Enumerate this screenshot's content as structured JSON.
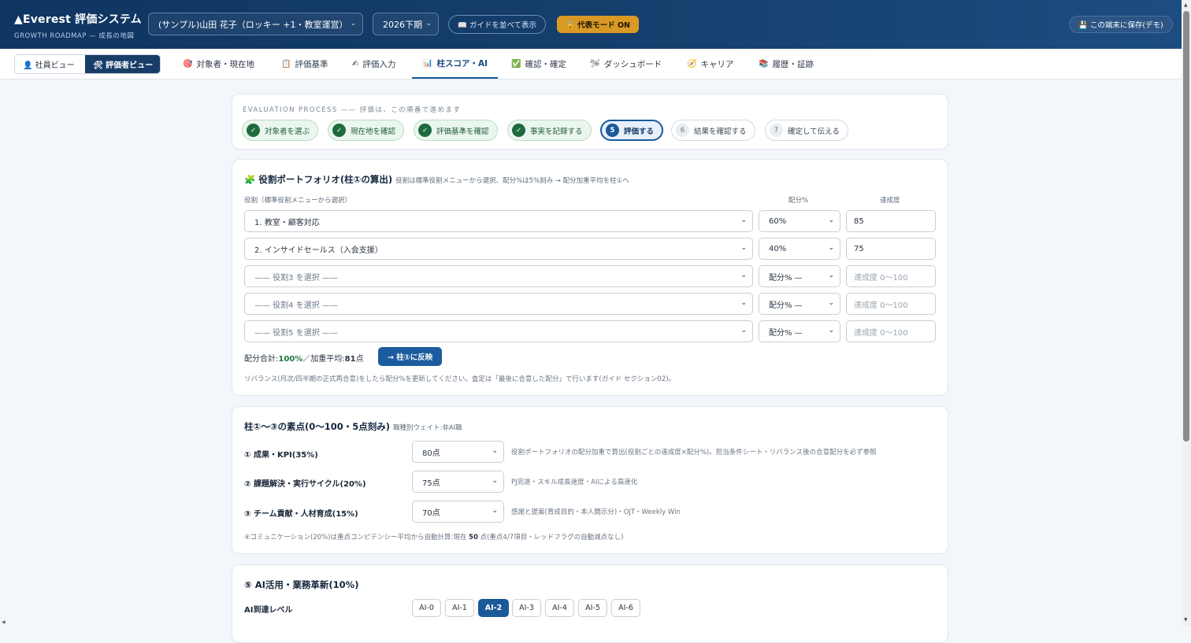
{
  "header": {
    "logo_title": "▲Everest 評価システム",
    "logo_subtitle": "GROWTH ROADMAP — 成長の地図",
    "person_select": "(サンプル)山田 花子（ロッキー +1・教室運営）",
    "period_select": "2026下期",
    "guide_button": "📖 ガイドを並べて表示",
    "rep_mode_button": "🔒 代表モード ON",
    "save_button": "💾 この端末に保存(デモ)"
  },
  "view_toggle": {
    "employee": "👤 社員ビュー",
    "evaluator": "🛠 評価者ビュー"
  },
  "tabs": [
    {
      "icon": "🎯",
      "label": "対象者・現在地"
    },
    {
      "icon": "📋",
      "label": "評価基準"
    },
    {
      "icon": "✍",
      "label": "評価入力"
    },
    {
      "icon": "📊",
      "label": "柱スコア・AI"
    },
    {
      "icon": "✅",
      "label": "確認・確定"
    },
    {
      "icon": "🛩",
      "label": "ダッシュボード"
    },
    {
      "icon": "🧭",
      "label": "キャリア"
    },
    {
      "icon": "📚",
      "label": "履歴・証跡"
    }
  ],
  "process": {
    "label": "EVALUATION PROCESS —— 評価は、この順番で進めます",
    "steps": [
      {
        "badge": "✓",
        "label": "対象者を選ぶ"
      },
      {
        "badge": "✓",
        "label": "現在地を確認"
      },
      {
        "badge": "✓",
        "label": "評価基準を確認"
      },
      {
        "badge": "✓",
        "label": "事実を記録する"
      },
      {
        "badge": "5",
        "label": "評価する"
      },
      {
        "badge": "6",
        "label": "結果を確認する"
      },
      {
        "badge": "7",
        "label": "確定して伝える"
      }
    ]
  },
  "portfolio": {
    "title": "🧩 役割ポートフォリオ(柱①の算出)",
    "subtitle": "役割は標準役割メニューから選択、配分%は5%刻み → 配分加重平均を柱①へ",
    "col_role": "役割（標準役割メニューから選択）",
    "col_alloc": "配分%",
    "col_ach": "達成度",
    "rows": [
      {
        "role": "1. 教室・顧客対応",
        "alloc": "60%",
        "ach": "85"
      },
      {
        "role": "2. インサイドセールス（入会支援）",
        "alloc": "40%",
        "ach": "75"
      },
      {
        "role": "—— 役割3 を選択 ——",
        "alloc": "配分% —",
        "ach": "達成度 0〜100"
      },
      {
        "role": "—— 役割4 を選択 ——",
        "alloc": "配分% —",
        "ach": "達成度 0〜100"
      },
      {
        "role": "—— 役割5 を選択 ——",
        "alloc": "配分% —",
        "ach": "達成度 0〜100"
      }
    ],
    "sum_label": "配分合計:",
    "sum_value": "100%",
    "avg_label": "／加重平均:",
    "avg_value": "81",
    "avg_unit": "点",
    "reflect_button": "→ 柱①に反映",
    "note": "リバランス(月次/四半期の正式再合意)をしたら配分%を更新してください。査定は「最後に合意した配分」で行います(ガイド セクション02)。"
  },
  "pillars": {
    "title": "柱①〜③の素点(0〜100・5点刻み)",
    "subtitle": "職種別ウェイト:非AI職",
    "items": [
      {
        "label": "① 成果・KPI(35%)",
        "value": "80点",
        "desc": "役割ポートフォリオの配分加重で算出(役割ごとの達成度×配分%)。担当条件シート・リバランス後の合意配分を必ず参照"
      },
      {
        "label": "② 課題解決・実行サイクル(20%)",
        "value": "75点",
        "desc": "PJ完遂・スキル成長速度・AIによる高速化"
      },
      {
        "label": "③ チーム貢献・人材育成(15%)",
        "value": "70点",
        "desc": "感謝と提案(育成目的・本人開示分)・OJT・Weekly Win"
      }
    ],
    "note_prefix": "④コミュニケーション(20%)は重点コンピテンシー平均から自動計算:現在 ",
    "note_value": "50",
    "note_suffix": " 点(重点4/7項目・レッドフラグの自動減点なし)"
  },
  "ai": {
    "title": "⑤ AI活用・業務革新(10%)",
    "level_label": "AI到達レベル",
    "levels": [
      "AI-0",
      "AI-1",
      "AI-2",
      "AI-3",
      "AI-4",
      "AI-5",
      "AI-6"
    ],
    "selected": "AI-2"
  },
  "colors": {
    "header_bg": "#0f3562",
    "accent": "#1a5a99",
    "done": "#1f6b3e",
    "rep_mode": "#d99a25"
  }
}
